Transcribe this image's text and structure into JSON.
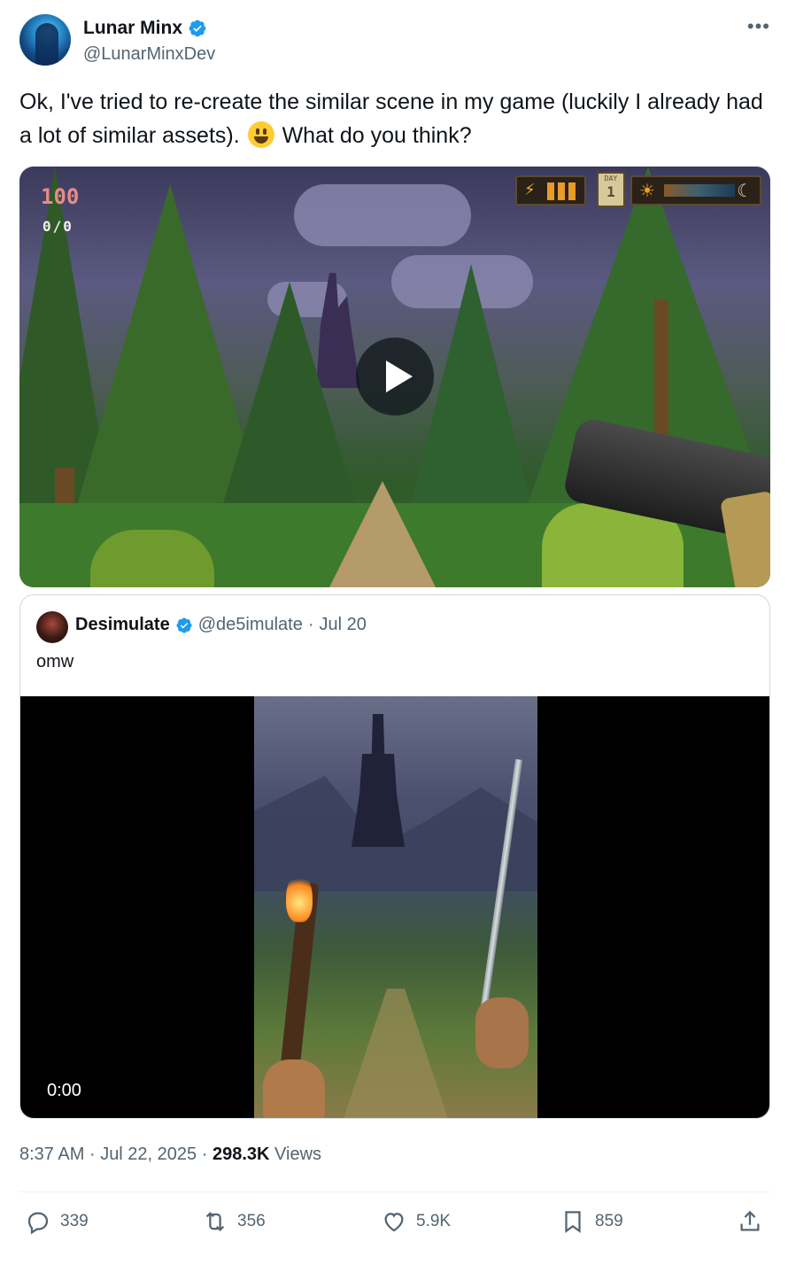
{
  "author": {
    "name": "Lunar Minx",
    "handle": "@LunarMinxDev",
    "verified_color": "#1d9bf0"
  },
  "tweet": {
    "text_before_emoji": "Ok, I've tried to re-create the similar scene in my game (luckily I already had a lot of similar assets). ",
    "emoji": "grinning-face",
    "text_after_emoji": " What do you think?"
  },
  "media_hud": {
    "health": "100",
    "ammo": "0/0",
    "day_label": "DAY",
    "day_number": "1"
  },
  "quoted": {
    "name": "Desimulate",
    "handle": "@de5imulate",
    "separator": "·",
    "date": "Jul 20",
    "text": "omw",
    "video_time": "0:00"
  },
  "meta": {
    "time": "8:37 AM",
    "separator": "·",
    "date": "Jul 22, 2025",
    "views_count": "298.3K",
    "views_label": "Views"
  },
  "actions": {
    "replies": "339",
    "reposts": "356",
    "likes": "5.9K",
    "bookmarks": "859"
  },
  "icons": {
    "more": "more-icon",
    "verified": "verified-badge-icon",
    "reply": "reply-icon",
    "repost": "repost-icon",
    "like": "heart-icon",
    "bookmark": "bookmark-icon",
    "share": "share-icon",
    "play": "play-icon"
  },
  "colors": {
    "text_primary": "#0f1419",
    "text_secondary": "#536471",
    "accent": "#1d9bf0",
    "border": "#cfd9de"
  }
}
